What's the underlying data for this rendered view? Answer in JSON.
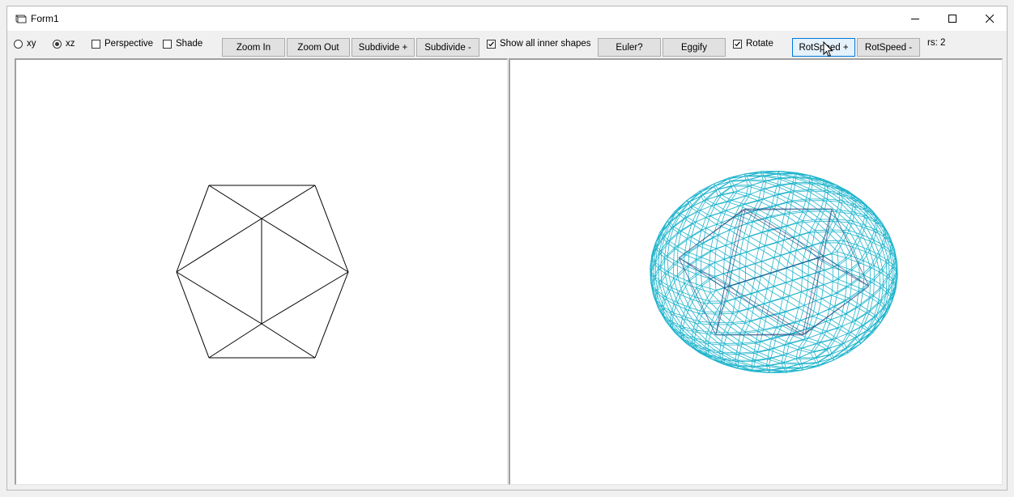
{
  "window": {
    "title": "Form1"
  },
  "view_modes": [
    {
      "label": "xy",
      "selected": false
    },
    {
      "label": "xz",
      "selected": true
    }
  ],
  "options": {
    "perspective": {
      "label": "Perspective",
      "checked": false
    },
    "shade": {
      "label": "Shade",
      "checked": false
    },
    "show_inner": {
      "label": "Show all inner shapes",
      "checked": true
    },
    "rotate": {
      "label": "Rotate",
      "checked": true
    }
  },
  "buttons": {
    "zoom_in": "Zoom In",
    "zoom_out": "Zoom Out",
    "subdivide_plus": "Subdivide +",
    "subdivide_minus": "Subdivide -",
    "euler": "Euler?",
    "eggify": "Eggify",
    "rotspeed_plus": "RotSpeed +",
    "rotspeed_minus": "RotSpeed -"
  },
  "status": {
    "rs": "rs: 2"
  },
  "colors": {
    "wire_left": "#000000",
    "wire_right": "#1fb4cc",
    "wire_right_inner": "#1c3f7a"
  },
  "icons": [
    "app-form-icon",
    "minimize-icon",
    "maximize-icon",
    "close-icon",
    "arrow-cursor-icon"
  ]
}
